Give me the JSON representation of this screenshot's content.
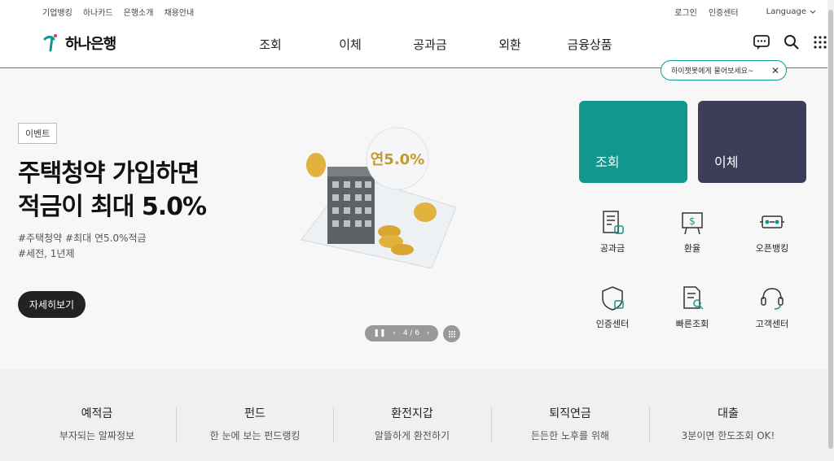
{
  "util": {
    "left": [
      "기업뱅킹",
      "하나카드",
      "은행소개",
      "채용안내"
    ],
    "login": "로그인",
    "cert": "인증센터",
    "language": "Language"
  },
  "header": {
    "logo": "하나은행",
    "nav": [
      "조회",
      "이체",
      "공과금",
      "외환",
      "금융상품"
    ]
  },
  "chat_tip": "하이챗봇에게 물어보세요~",
  "hero": {
    "badge": "이벤트",
    "title_line1": "주택청약 가입하면",
    "title_line2": "적금이 최대 5.0%",
    "tags_line1": "#주택청약 #최대 연5.0%적금",
    "tags_line2": "#세전, 1년제",
    "button": "자세히보기",
    "illust_rate": "연5.0%",
    "pager": "4 / 6"
  },
  "tiles": {
    "inquiry": "조회",
    "transfer": "이체"
  },
  "quick_menu": [
    {
      "label": "공과금",
      "icon": "bill-icon"
    },
    {
      "label": "환율",
      "icon": "exchange-rate-icon"
    },
    {
      "label": "오픈뱅킹",
      "icon": "open-banking-icon"
    },
    {
      "label": "인증센터",
      "icon": "shield-lock-icon"
    },
    {
      "label": "빠른조회",
      "icon": "document-search-icon"
    },
    {
      "label": "고객센터",
      "icon": "headset-icon"
    }
  ],
  "categories": [
    {
      "title": "예적금",
      "sub": "부자되는 알짜정보"
    },
    {
      "title": "펀드",
      "sub": "한 눈에 보는 펀드랭킹"
    },
    {
      "title": "환전지갑",
      "sub": "알뜰하게 환전하기"
    },
    {
      "title": "퇴직연금",
      "sub": "든든한 노후를 위해"
    },
    {
      "title": "대출",
      "sub": "3분이면 한도조회 OK!"
    }
  ],
  "colors": {
    "accent": "#12978e",
    "navy": "#3c3d59"
  }
}
